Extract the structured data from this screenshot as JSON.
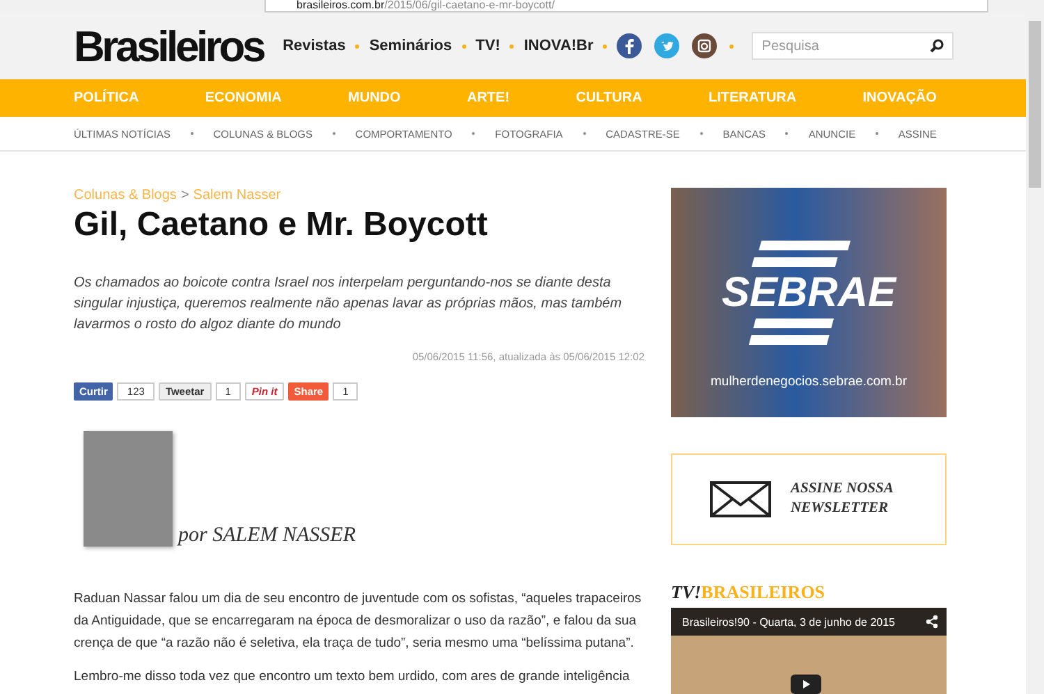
{
  "browser": {
    "url_host": "brasileiros.com.br",
    "url_path": "/2015/06/gil-caetano-e-mr-boycott/"
  },
  "header": {
    "logo": "Brasileiros",
    "links": [
      "Revistas",
      "Seminários",
      "TV!",
      "INOVA!Br"
    ],
    "search": {
      "placeholder": "Pesquisa"
    }
  },
  "nav": [
    "POLÍTICA",
    "ECONOMIA",
    "MUNDO",
    "ARTE!",
    "CULTURA",
    "LITERATURA",
    "INOVAÇÃO"
  ],
  "subnav": [
    "ÚLTIMAS NOTÍCIAS",
    "COLUNAS & BLOGS",
    "COMPORTAMENTO",
    "FOTOGRAFIA",
    "CADASTRE-SE",
    "BANCAS",
    "ANUNCIE",
    "ASSINE"
  ],
  "article": {
    "breadcrumb": [
      "Colunas & Blogs",
      "Salem Nasser"
    ],
    "breadcrumb_separator": ">",
    "title": "Gil, Caetano e Mr. Boycott",
    "lead": "Os chamados ao boicote contra Israel nos interpelam perguntando-nos se diante desta singular injustiça, queremos realmente não apenas lavar as próprias mãos, mas também lavarmos o rosto do algoz diante do mundo",
    "date": "05/06/2015 11:56, atualizada às 05/06/2015 12:02",
    "share": [
      {
        "kind": "facebook",
        "label": "Curtir",
        "count": "123"
      },
      {
        "kind": "twitter",
        "label": "Tweetar",
        "count": "1"
      },
      {
        "kind": "pinterest",
        "label": "Pin it"
      },
      {
        "kind": "share",
        "label": "Share",
        "count": "1"
      }
    ],
    "author": "por SALEM NASSER",
    "paragraphs": [
      "Raduan Nassar falou um dia de seu encontro de juventude com os sofistas, “aqueles trapaceiros da Antiguidade, que se encarregaram na época de desmoralizar o uso da razão”, e falou da sua crença de que “a razão não é seletiva, ela traça de tudo”, seria mesmo uma “belíssima putana”.",
      "Lembro-me disso toda vez que encontro um texto bem urdido, com ares de grande inteligência"
    ]
  },
  "sidebar": {
    "ad": {
      "brand": "SEBRAE",
      "url": "mulherdenegocios.sebrae.com.br"
    },
    "newsletter": "ASSINE NOSSA NEWSLETTER",
    "tv_heading": {
      "prefix": "TV!",
      "name": "BRASILEIROS"
    },
    "video": {
      "title": "Brasileiros!90 - Quarta, 3 de junho de 2015"
    }
  }
}
